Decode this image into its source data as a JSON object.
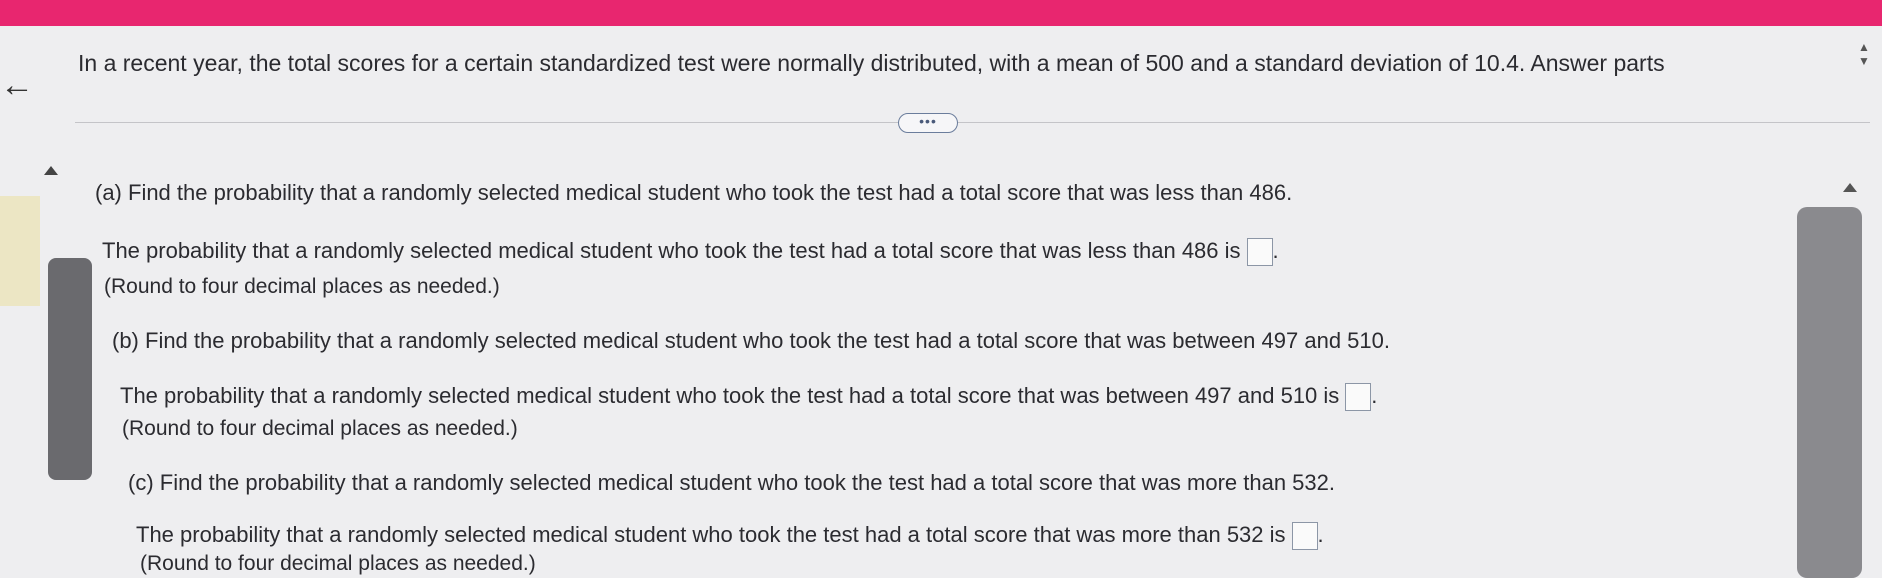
{
  "intro": "In a recent year, the total scores for a certain standardized test were normally distributed, with a mean of 500 and a standard deviation of 10.4. Answer parts",
  "more_button": "•••",
  "parts": [
    {
      "question": "(a) Find the probability that a randomly selected medical student who took the test had a total score that was less than 486.",
      "answer_prompt": "The probability that a randomly selected medical student who took the test had a total score that was less than 486 is",
      "answer_value": "",
      "note": "(Round to four decimal places as needed.)"
    },
    {
      "question": "(b) Find the probability that a randomly selected medical student who took the test had a total score that was between 497 and 510.",
      "answer_prompt": "The probability that a randomly selected medical student who took the test had a total score that was between 497 and 510 is",
      "answer_value": "",
      "note": "(Round to four decimal places as needed.)"
    },
    {
      "question": "(c) Find the probability that a randomly selected medical student who took the test had a total score that was more than 532.",
      "answer_prompt": "The probability that a randomly selected medical student who took the test had a total score that was more than 532 is",
      "answer_value": "",
      "note": "(Round to four decimal places as needed.)"
    }
  ],
  "colors": {
    "header_bar": "#e8266f",
    "background": "#eeeef0",
    "answer_box_border": "#8c96a6"
  },
  "icons": {
    "back": "arrow-left-icon",
    "resize": "up-down-arrows-icon",
    "expand": "ellipsis-icon"
  }
}
